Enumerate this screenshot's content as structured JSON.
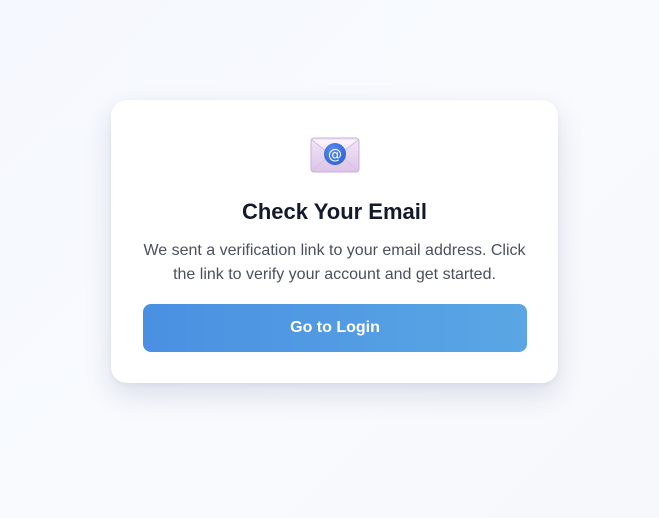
{
  "card": {
    "icon": "email-envelope-at-icon",
    "title": "Check Your Email",
    "message": "We sent a verification link to your email address. Click the link to verify your account and get started.",
    "button_label": "Go to Login"
  },
  "colors": {
    "accent_start": "#4a90e2",
    "accent_end": "#5aa6e4",
    "title_text": "#141a2a",
    "body_text": "#4a505c",
    "card_background": "#ffffff",
    "page_background": "#f6f8fd"
  }
}
